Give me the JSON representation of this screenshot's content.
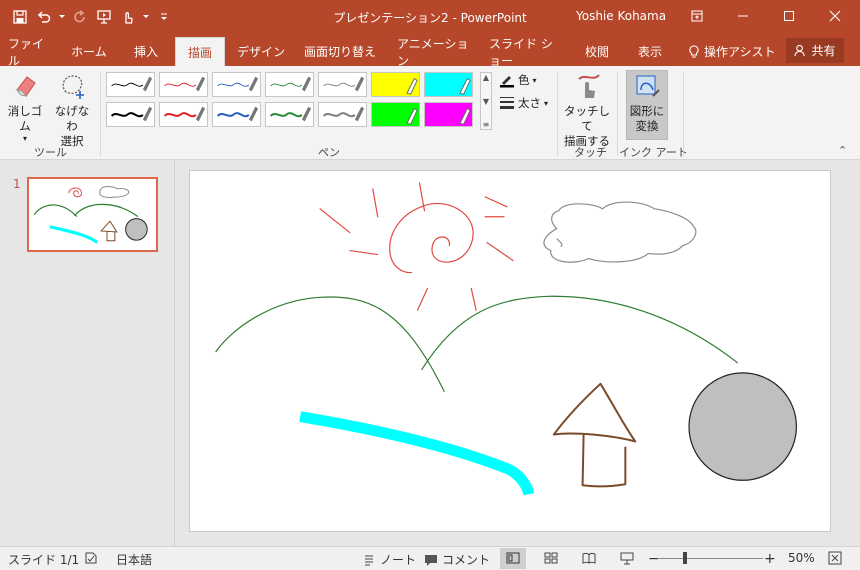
{
  "app": {
    "title": "プレゼンテーション2 - PowerPoint",
    "user": "Yoshie Kohama"
  },
  "tabs": [
    {
      "label": "ファイル"
    },
    {
      "label": "ホーム"
    },
    {
      "label": "挿入"
    },
    {
      "label": "描画",
      "active": true
    },
    {
      "label": "デザイン"
    },
    {
      "label": "画面切り替え"
    },
    {
      "label": "アニメーション"
    },
    {
      "label": "スライド ショー"
    },
    {
      "label": "校閲"
    },
    {
      "label": "表示"
    }
  ],
  "tell_me": "操作アシスト",
  "share": "共有",
  "ribbon": {
    "tools": {
      "group_label": "ツール",
      "eraser": "消しゴム",
      "lasso_line1": "なげなわ",
      "lasso_line2": "選択"
    },
    "pens": {
      "group_label": "ペン",
      "items": [
        {
          "color": "#000000",
          "kind": "pen",
          "weight": "thin"
        },
        {
          "color": "#e0202a",
          "kind": "pen",
          "weight": "thin"
        },
        {
          "color": "#2a5fbf",
          "kind": "pen",
          "weight": "thin"
        },
        {
          "color": "#2a8a3a",
          "kind": "pen",
          "weight": "thin"
        },
        {
          "color": "#7f7f7f",
          "kind": "pen",
          "weight": "thin"
        },
        {
          "color": "#ffff00",
          "kind": "highlighter"
        },
        {
          "color": "#00ffff",
          "kind": "highlighter"
        },
        {
          "color": "#000000",
          "kind": "pen",
          "weight": "thick"
        },
        {
          "color": "#e0202a",
          "kind": "pen",
          "weight": "thick"
        },
        {
          "color": "#2a5fbf",
          "kind": "pen",
          "weight": "thick"
        },
        {
          "color": "#2a8a3a",
          "kind": "pen",
          "weight": "thick"
        },
        {
          "color": "#7f7f7f",
          "kind": "pen",
          "weight": "thick"
        },
        {
          "color": "#00ff00",
          "kind": "highlighter"
        },
        {
          "color": "#ff00ff",
          "kind": "highlighter"
        }
      ],
      "color_label": "色",
      "thickness_label": "太さ"
    },
    "touch": {
      "group_label": "タッチ",
      "button_line1": "タッチして",
      "button_line2": "描画する"
    },
    "ink_art": {
      "group_label": "インク アート",
      "button_line1": "図形に",
      "button_line2": "変換"
    }
  },
  "thumbnails": [
    {
      "number": "1"
    }
  ],
  "slide_ink": {
    "sun_color": "#e04a3f",
    "cloud_color": "#8a8a8a",
    "hills_color": "#2e7d32",
    "highlight_color": "#00ffff",
    "house_color": "#7a4a2a",
    "circle_fill": "#bfbfbf",
    "circle_stroke": "#222222"
  },
  "status": {
    "slide": "スライド 1/1",
    "language": "日本語",
    "notes": "ノート",
    "comments": "コメント",
    "zoom": "50%"
  }
}
